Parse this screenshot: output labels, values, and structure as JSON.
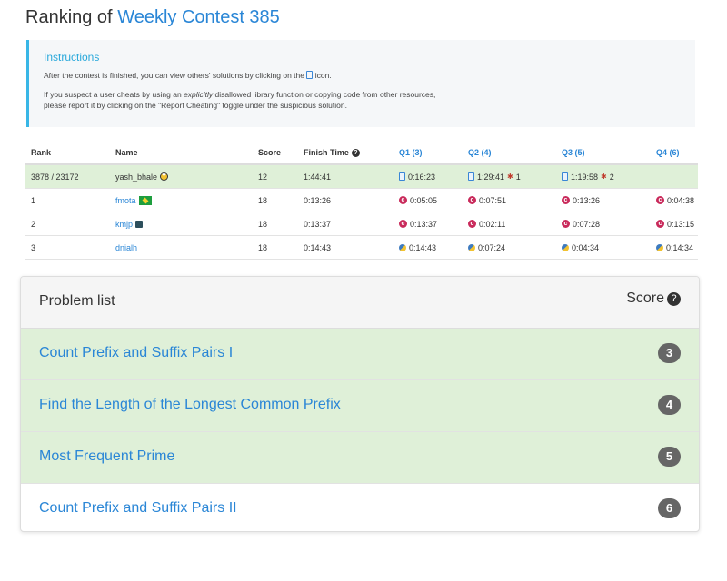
{
  "title": {
    "prefix": "Ranking of",
    "contest": "Weekly Contest 385"
  },
  "instructions": {
    "heading": "Instructions",
    "line1_before": "After the contest is finished, you can view others' solutions by clicking on the",
    "line1_after": "icon.",
    "line2_before": "If you suspect a user cheats by using an",
    "line2_emph": "explicitly",
    "line2_after": "disallowed library function or copying code from other resources,",
    "line3": "please report it by clicking on the \"Report Cheating\" toggle under the suspicious solution."
  },
  "ranking": {
    "headers": {
      "rank": "Rank",
      "name": "Name",
      "score": "Score",
      "finish": "Finish Time",
      "q1": "Q1 (3)",
      "q2": "Q2 (4)",
      "q3": "Q3 (5)",
      "q4": "Q4 (6)"
    },
    "rows": [
      {
        "rank": "3878 / 23172",
        "name": "yash_bhale",
        "score": "12",
        "finish": "1:44:41",
        "q1": "0:16:23",
        "q2": "1:29:41",
        "q2_wrong": "1",
        "q3": "1:19:58",
        "q3_wrong": "2",
        "q4": ""
      },
      {
        "rank": "1",
        "name": "fmota",
        "score": "18",
        "finish": "0:13:26",
        "q1": "0:05:05",
        "q2": "0:07:51",
        "q3": "0:13:26",
        "q4": "0:04:38"
      },
      {
        "rank": "2",
        "name": "kmjp",
        "score": "18",
        "finish": "0:13:37",
        "q1": "0:13:37",
        "q2": "0:02:11",
        "q3": "0:07:28",
        "q4": "0:13:15"
      },
      {
        "rank": "3",
        "name": "dnialh",
        "score": "18",
        "finish": "0:14:43",
        "q1": "0:14:43",
        "q2": "0:07:24",
        "q3": "0:04:34",
        "q4": "0:14:34"
      }
    ]
  },
  "problem_list": {
    "title": "Problem list",
    "score_label": "Score",
    "items": [
      {
        "name": "Count Prefix and Suffix Pairs I",
        "score": "3"
      },
      {
        "name": "Find the Length of the Longest Common Prefix",
        "score": "4"
      },
      {
        "name": "Most Frequent Prime",
        "score": "5"
      },
      {
        "name": "Count Prefix and Suffix Pairs II",
        "score": "6"
      }
    ]
  },
  "colors": {
    "accent": "#2a86d6",
    "solved_bg": "#dff0d8",
    "info_border": "#38b6e6"
  }
}
